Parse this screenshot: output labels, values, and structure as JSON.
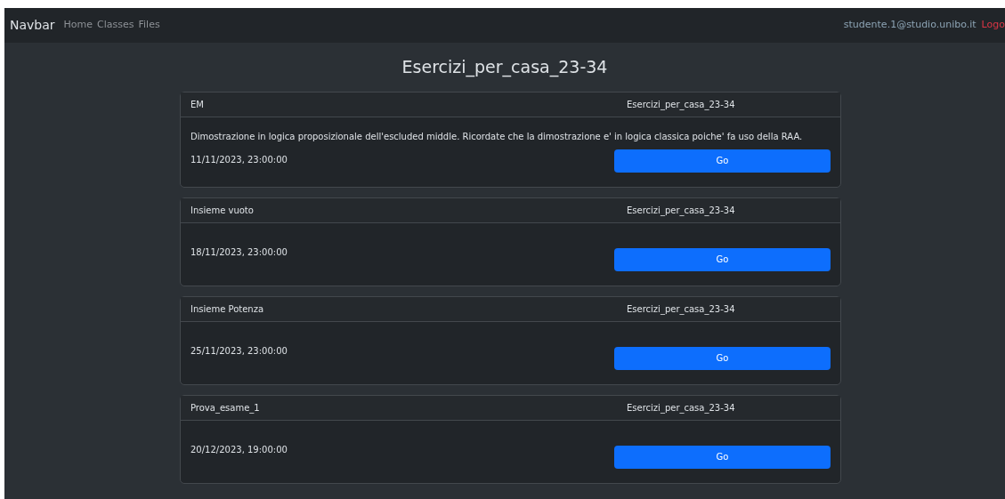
{
  "navbar": {
    "brand": "Navbar",
    "links": [
      "Home",
      "Classes",
      "Files"
    ],
    "user": "studente.1@studio.unibo.it",
    "logout": "Logo"
  },
  "title": "Esercizi_per_casa_23-34",
  "cards": [
    {
      "name": "EM",
      "course": "Esercizi_per_casa_23-34",
      "description": "Dimostrazione in logica proposizionale dell'escluded middle. Ricordate che la dimostrazione e' in logica classica poiche' fa uso della RAA.",
      "date": "11/11/2023, 23:00:00",
      "button": "Go"
    },
    {
      "name": "Insieme vuoto",
      "course": "Esercizi_per_casa_23-34",
      "date": "18/11/2023, 23:00:00",
      "button": "Go"
    },
    {
      "name": "Insieme Potenza",
      "course": "Esercizi_per_casa_23-34",
      "date": "25/11/2023, 23:00:00",
      "button": "Go"
    },
    {
      "name": "Prova_esame_1",
      "course": "Esercizi_per_casa_23-34",
      "date": "20/12/2023, 19:00:00",
      "button": "Go"
    }
  ]
}
